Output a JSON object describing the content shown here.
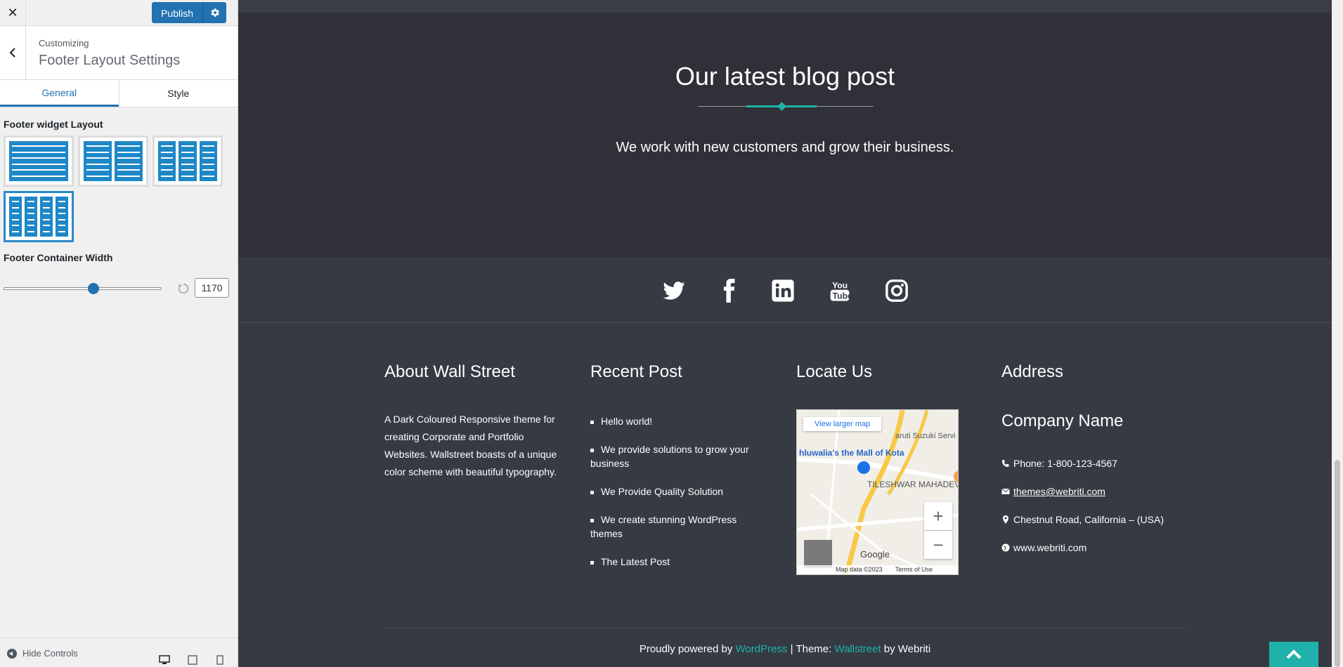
{
  "topbar": {
    "close_glyph": "✕",
    "publish_label": "Publish"
  },
  "section": {
    "label": "Customizing",
    "title": "Footer Layout Settings"
  },
  "tabs": [
    {
      "label": "General"
    },
    {
      "label": "Style"
    }
  ],
  "controls": {
    "layout_label": "Footer widget Layout",
    "layout_options": [
      {
        "columns": 1,
        "selected": false
      },
      {
        "columns": 2,
        "selected": false
      },
      {
        "columns": 3,
        "selected": false
      },
      {
        "columns": 4,
        "selected": true
      }
    ],
    "width_label": "Footer Container Width",
    "width_value": "1170",
    "slider_fraction": 0.57
  },
  "bottom_bar": {
    "hide_controls_label": "Hide Controls",
    "devices": [
      "desktop-icon",
      "tablet-icon",
      "mobile-icon"
    ]
  },
  "blog": {
    "title": "Our latest blog post",
    "subtitle": "We work with new customers and grow their business."
  },
  "social": [
    "twitter-icon",
    "facebook-icon",
    "linkedin-icon",
    "youtube-icon",
    "instagram-icon"
  ],
  "footer": {
    "about": {
      "title": "About Wall Street",
      "text": "A Dark Coloured Responsive theme for creating Corporate and Portfolio Websites. Wallstreet boasts of a unique color scheme with beautiful typography."
    },
    "recent": {
      "title": "Recent Post",
      "items": [
        "Hello world!",
        "We provide solutions to grow your business",
        "We Provide Quality Solution",
        "We create stunning WordPress themes",
        "The Latest Post"
      ]
    },
    "locate": {
      "title": "Locate Us",
      "map_link": "View larger map",
      "map_labels": {
        "mall": "hluwalia's the Mall of Kota",
        "suzuki": "aruti Suzuki Servi (Bhatia & Compan",
        "area": "TILESHWAR MAHADEV MANDIR",
        "google": "Google",
        "map_data": "Map data ©2023",
        "terms": "Terms of Use"
      }
    },
    "address": {
      "title": "Address",
      "company": "Company Name",
      "phone": "Phone: 1-800-123-4567",
      "email": "themes@webriti.com",
      "location": "Chestnut Road, California – (USA)",
      "website": "www.webriti.com"
    },
    "copyright": {
      "prefix": "Proudly powered by ",
      "wp": "WordPress",
      "mid": " | Theme: ",
      "theme": "Wallstreet",
      "suffix": " by Webriti"
    }
  },
  "colors": {
    "accent": "#20b2aa",
    "wp_blue": "#2271b1",
    "footer_bg": "#363a43",
    "blog_bg": "#2f3038"
  }
}
